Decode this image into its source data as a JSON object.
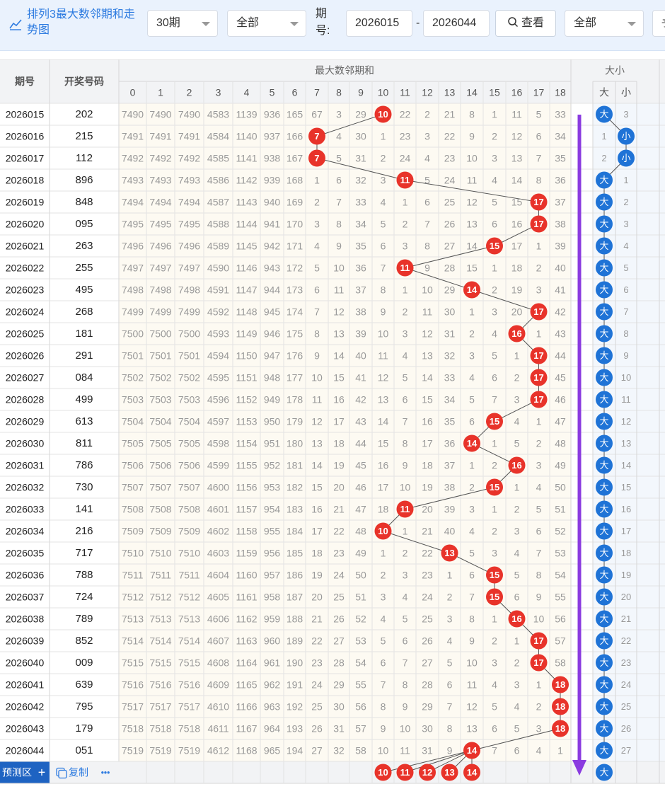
{
  "toolbar": {
    "title": "排列3最大数邻期和走势图",
    "periods_select": "30期",
    "filter_select": "全部",
    "issue_label": "期号:",
    "issue_from": "2026015",
    "issue_to": "2026044",
    "range_dash": "-",
    "query_button": "查看",
    "filter2_select": "全部",
    "extra_select_glyph": "予"
  },
  "table": {
    "header_issue": "期号",
    "header_draw": "开奖号码",
    "group_sum": "最大数邻期和",
    "group_size": "大小",
    "size_big": "大",
    "size_small": "小",
    "columns": [
      "0",
      "1",
      "2",
      "3",
      "4",
      "5",
      "6",
      "7",
      "8",
      "9",
      "10",
      "11",
      "12",
      "13",
      "14",
      "15",
      "16",
      "17",
      "18"
    ],
    "rows": [
      {
        "issue": "2026015",
        "draw": "202",
        "values": [
          "7490",
          "7490",
          "7490",
          "4583",
          "1139",
          "936",
          "165",
          "67",
          "3",
          "29",
          "10",
          "22",
          "2",
          "21",
          "8",
          "1",
          "11",
          "5",
          "33"
        ],
        "hit": 10,
        "big": "大",
        "big_hit": true,
        "size_other": "3"
      },
      {
        "issue": "2026016",
        "draw": "215",
        "values": [
          "7491",
          "7491",
          "7491",
          "4584",
          "1140",
          "937",
          "166",
          "7",
          "4",
          "30",
          "1",
          "23",
          "3",
          "22",
          "9",
          "2",
          "12",
          "6",
          "34"
        ],
        "hit": 7,
        "big": "1",
        "big_hit": false,
        "size_other": "小"
      },
      {
        "issue": "2026017",
        "draw": "112",
        "values": [
          "7492",
          "7492",
          "7492",
          "4585",
          "1141",
          "938",
          "167",
          "7",
          "5",
          "31",
          "2",
          "24",
          "4",
          "23",
          "10",
          "3",
          "13",
          "7",
          "35"
        ],
        "hit": 7,
        "big": "2",
        "big_hit": false,
        "size_other": "小"
      },
      {
        "issue": "2026018",
        "draw": "896",
        "values": [
          "7493",
          "7493",
          "7493",
          "4586",
          "1142",
          "939",
          "168",
          "1",
          "6",
          "32",
          "3",
          "11",
          "5",
          "24",
          "11",
          "4",
          "14",
          "8",
          "36"
        ],
        "hit": 11,
        "big": "大",
        "big_hit": true,
        "size_other": "1"
      },
      {
        "issue": "2026019",
        "draw": "848",
        "values": [
          "7494",
          "7494",
          "7494",
          "4587",
          "1143",
          "940",
          "169",
          "2",
          "7",
          "33",
          "4",
          "1",
          "6",
          "25",
          "12",
          "5",
          "15",
          "17",
          "37"
        ],
        "hit": 17,
        "big": "大",
        "big_hit": true,
        "size_other": "2"
      },
      {
        "issue": "2026020",
        "draw": "095",
        "values": [
          "7495",
          "7495",
          "7495",
          "4588",
          "1144",
          "941",
          "170",
          "3",
          "8",
          "34",
          "5",
          "2",
          "7",
          "26",
          "13",
          "6",
          "16",
          "17",
          "38"
        ],
        "hit": 17,
        "big": "大",
        "big_hit": true,
        "size_other": "3"
      },
      {
        "issue": "2026021",
        "draw": "263",
        "values": [
          "7496",
          "7496",
          "7496",
          "4589",
          "1145",
          "942",
          "171",
          "4",
          "9",
          "35",
          "6",
          "3",
          "8",
          "27",
          "14",
          "15",
          "17",
          "1",
          "39"
        ],
        "hit": 15,
        "big": "大",
        "big_hit": true,
        "size_other": "4"
      },
      {
        "issue": "2026022",
        "draw": "255",
        "values": [
          "7497",
          "7497",
          "7497",
          "4590",
          "1146",
          "943",
          "172",
          "5",
          "10",
          "36",
          "7",
          "11",
          "9",
          "28",
          "15",
          "1",
          "18",
          "2",
          "40"
        ],
        "hit": 11,
        "big": "大",
        "big_hit": true,
        "size_other": "5"
      },
      {
        "issue": "2026023",
        "draw": "495",
        "values": [
          "7498",
          "7498",
          "7498",
          "4591",
          "1147",
          "944",
          "173",
          "6",
          "11",
          "37",
          "8",
          "1",
          "10",
          "29",
          "14",
          "2",
          "19",
          "3",
          "41"
        ],
        "hit": 14,
        "big": "大",
        "big_hit": true,
        "size_other": "6"
      },
      {
        "issue": "2026024",
        "draw": "268",
        "values": [
          "7499",
          "7499",
          "7499",
          "4592",
          "1148",
          "945",
          "174",
          "7",
          "12",
          "38",
          "9",
          "2",
          "11",
          "30",
          "1",
          "3",
          "20",
          "17",
          "42"
        ],
        "hit": 17,
        "big": "大",
        "big_hit": true,
        "size_other": "7"
      },
      {
        "issue": "2026025",
        "draw": "181",
        "values": [
          "7500",
          "7500",
          "7500",
          "4593",
          "1149",
          "946",
          "175",
          "8",
          "13",
          "39",
          "10",
          "3",
          "12",
          "31",
          "2",
          "4",
          "16",
          "1",
          "43"
        ],
        "hit": 16,
        "big": "大",
        "big_hit": true,
        "size_other": "8"
      },
      {
        "issue": "2026026",
        "draw": "291",
        "values": [
          "7501",
          "7501",
          "7501",
          "4594",
          "1150",
          "947",
          "176",
          "9",
          "14",
          "40",
          "11",
          "4",
          "13",
          "32",
          "3",
          "5",
          "1",
          "17",
          "44"
        ],
        "hit": 17,
        "big": "大",
        "big_hit": true,
        "size_other": "9"
      },
      {
        "issue": "2026027",
        "draw": "084",
        "values": [
          "7502",
          "7502",
          "7502",
          "4595",
          "1151",
          "948",
          "177",
          "10",
          "15",
          "41",
          "12",
          "5",
          "14",
          "33",
          "4",
          "6",
          "2",
          "17",
          "45"
        ],
        "hit": 17,
        "big": "大",
        "big_hit": true,
        "size_other": "10"
      },
      {
        "issue": "2026028",
        "draw": "499",
        "values": [
          "7503",
          "7503",
          "7503",
          "4596",
          "1152",
          "949",
          "178",
          "11",
          "16",
          "42",
          "13",
          "6",
          "15",
          "34",
          "5",
          "7",
          "3",
          "17",
          "46"
        ],
        "hit": 17,
        "big": "大",
        "big_hit": true,
        "size_other": "11"
      },
      {
        "issue": "2026029",
        "draw": "613",
        "values": [
          "7504",
          "7504",
          "7504",
          "4597",
          "1153",
          "950",
          "179",
          "12",
          "17",
          "43",
          "14",
          "7",
          "16",
          "35",
          "6",
          "15",
          "4",
          "1",
          "47"
        ],
        "hit": 15,
        "big": "大",
        "big_hit": true,
        "size_other": "12"
      },
      {
        "issue": "2026030",
        "draw": "811",
        "values": [
          "7505",
          "7505",
          "7505",
          "4598",
          "1154",
          "951",
          "180",
          "13",
          "18",
          "44",
          "15",
          "8",
          "17",
          "36",
          "14",
          "1",
          "5",
          "2",
          "48"
        ],
        "hit": 14,
        "big": "大",
        "big_hit": true,
        "size_other": "13"
      },
      {
        "issue": "2026031",
        "draw": "786",
        "values": [
          "7506",
          "7506",
          "7506",
          "4599",
          "1155",
          "952",
          "181",
          "14",
          "19",
          "45",
          "16",
          "9",
          "18",
          "37",
          "1",
          "2",
          "16",
          "3",
          "49"
        ],
        "hit": 16,
        "big": "大",
        "big_hit": true,
        "size_other": "14"
      },
      {
        "issue": "2026032",
        "draw": "730",
        "values": [
          "7507",
          "7507",
          "7507",
          "4600",
          "1156",
          "953",
          "182",
          "15",
          "20",
          "46",
          "17",
          "10",
          "19",
          "38",
          "2",
          "15",
          "1",
          "4",
          "50"
        ],
        "hit": 15,
        "big": "大",
        "big_hit": true,
        "size_other": "15"
      },
      {
        "issue": "2026033",
        "draw": "141",
        "values": [
          "7508",
          "7508",
          "7508",
          "4601",
          "1157",
          "954",
          "183",
          "16",
          "21",
          "47",
          "18",
          "11",
          "20",
          "39",
          "3",
          "1",
          "2",
          "5",
          "51"
        ],
        "hit": 11,
        "big": "大",
        "big_hit": true,
        "size_other": "16"
      },
      {
        "issue": "2026034",
        "draw": "216",
        "values": [
          "7509",
          "7509",
          "7509",
          "4602",
          "1158",
          "955",
          "184",
          "17",
          "22",
          "48",
          "10",
          "1",
          "21",
          "40",
          "4",
          "2",
          "3",
          "6",
          "52"
        ],
        "hit": 10,
        "big": "大",
        "big_hit": true,
        "size_other": "17"
      },
      {
        "issue": "2026035",
        "draw": "717",
        "values": [
          "7510",
          "7510",
          "7510",
          "4603",
          "1159",
          "956",
          "185",
          "18",
          "23",
          "49",
          "1",
          "2",
          "22",
          "13",
          "5",
          "3",
          "4",
          "7",
          "53"
        ],
        "hit": 13,
        "big": "大",
        "big_hit": true,
        "size_other": "18"
      },
      {
        "issue": "2026036",
        "draw": "788",
        "values": [
          "7511",
          "7511",
          "7511",
          "4604",
          "1160",
          "957",
          "186",
          "19",
          "24",
          "50",
          "2",
          "3",
          "23",
          "1",
          "6",
          "15",
          "5",
          "8",
          "54"
        ],
        "hit": 15,
        "big": "大",
        "big_hit": true,
        "size_other": "19"
      },
      {
        "issue": "2026037",
        "draw": "724",
        "values": [
          "7512",
          "7512",
          "7512",
          "4605",
          "1161",
          "958",
          "187",
          "20",
          "25",
          "51",
          "3",
          "4",
          "24",
          "2",
          "7",
          "15",
          "6",
          "9",
          "55"
        ],
        "hit": 15,
        "big": "大",
        "big_hit": true,
        "size_other": "20"
      },
      {
        "issue": "2026038",
        "draw": "789",
        "values": [
          "7513",
          "7513",
          "7513",
          "4606",
          "1162",
          "959",
          "188",
          "21",
          "26",
          "52",
          "4",
          "5",
          "25",
          "3",
          "8",
          "1",
          "16",
          "10",
          "56"
        ],
        "hit": 16,
        "big": "大",
        "big_hit": true,
        "size_other": "21"
      },
      {
        "issue": "2026039",
        "draw": "852",
        "values": [
          "7514",
          "7514",
          "7514",
          "4607",
          "1163",
          "960",
          "189",
          "22",
          "27",
          "53",
          "5",
          "6",
          "26",
          "4",
          "9",
          "2",
          "1",
          "17",
          "57"
        ],
        "hit": 17,
        "big": "大",
        "big_hit": true,
        "size_other": "22"
      },
      {
        "issue": "2026040",
        "draw": "009",
        "values": [
          "7515",
          "7515",
          "7515",
          "4608",
          "1164",
          "961",
          "190",
          "23",
          "28",
          "54",
          "6",
          "7",
          "27",
          "5",
          "10",
          "3",
          "2",
          "17",
          "58"
        ],
        "hit": 17,
        "big": "大",
        "big_hit": true,
        "size_other": "23"
      },
      {
        "issue": "2026041",
        "draw": "639",
        "values": [
          "7516",
          "7516",
          "7516",
          "4609",
          "1165",
          "962",
          "191",
          "24",
          "29",
          "55",
          "7",
          "8",
          "28",
          "6",
          "11",
          "4",
          "3",
          "1",
          "18"
        ],
        "hit": 18,
        "big": "大",
        "big_hit": true,
        "size_other": "24"
      },
      {
        "issue": "2026042",
        "draw": "795",
        "values": [
          "7517",
          "7517",
          "7517",
          "4610",
          "1166",
          "963",
          "192",
          "25",
          "30",
          "56",
          "8",
          "9",
          "29",
          "7",
          "12",
          "5",
          "4",
          "2",
          "18"
        ],
        "hit": 18,
        "big": "大",
        "big_hit": true,
        "size_other": "25"
      },
      {
        "issue": "2026043",
        "draw": "179",
        "values": [
          "7518",
          "7518",
          "7518",
          "4611",
          "1167",
          "964",
          "193",
          "26",
          "31",
          "57",
          "9",
          "10",
          "30",
          "8",
          "13",
          "6",
          "5",
          "3",
          "18"
        ],
        "hit": 18,
        "big": "大",
        "big_hit": true,
        "size_other": "26"
      },
      {
        "issue": "2026044",
        "draw": "051",
        "values": [
          "7519",
          "7519",
          "7519",
          "4612",
          "1168",
          "965",
          "194",
          "27",
          "32",
          "58",
          "10",
          "11",
          "31",
          "9",
          "14",
          "7",
          "6",
          "4",
          "1"
        ],
        "hit": 14,
        "big": "大",
        "big_hit": true,
        "size_other": "27"
      }
    ]
  },
  "prediction": {
    "label": "预测区",
    "plus": "+",
    "copy": "复制",
    "more": "•••",
    "balls": [
      "10",
      "11",
      "12",
      "13",
      "14"
    ],
    "size_ball": "大"
  },
  "colors": {
    "accent_blue": "#2d7be0",
    "hit_red": "#e8332a",
    "big_blue": "#1f73d6",
    "arrow_purple": "#8a3be0"
  }
}
